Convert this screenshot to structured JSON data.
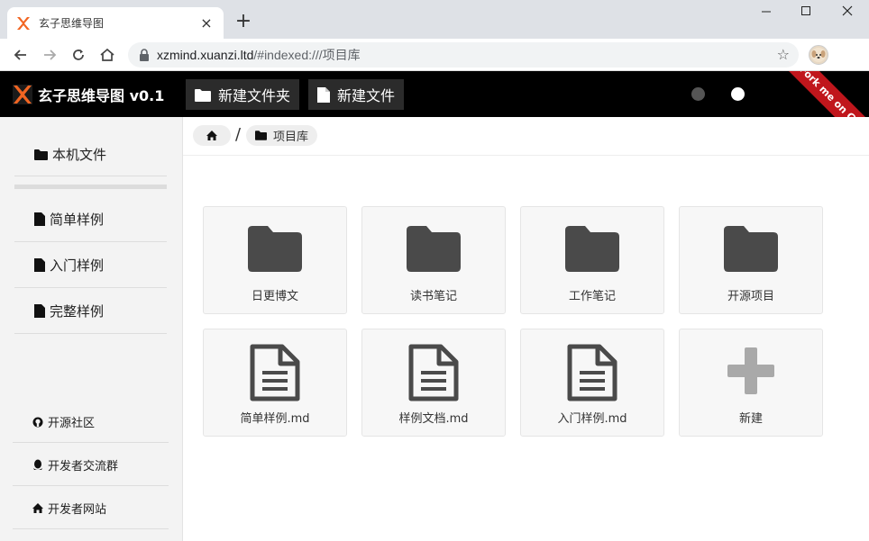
{
  "browser": {
    "tab_title": "玄子思维导图",
    "tab_close": "×",
    "new_tab": "+",
    "url_host": "xzmind.xuanzi.ltd",
    "url_rest": "/#indexed:///项目库"
  },
  "app": {
    "brand": "玄子思维导图 v0.1",
    "new_folder": "新建文件夹",
    "new_file": "新建文件",
    "ribbon": "Fork me on Gitee",
    "dark_dot_color": "#555555",
    "light_dot_color": "#ffffff",
    "accent": "#c0161c"
  },
  "sidebar": {
    "items": [
      {
        "label": "本机文件",
        "icon": "folder-icon"
      },
      {
        "label": "简单样例",
        "icon": "file-icon"
      },
      {
        "label": "入门样例",
        "icon": "file-icon"
      },
      {
        "label": "完整样例",
        "icon": "file-icon"
      }
    ],
    "links": [
      {
        "label": "开源社区",
        "icon": "github-icon"
      },
      {
        "label": "开发者交流群",
        "icon": "qq-icon"
      },
      {
        "label": "开发者网站",
        "icon": "home-icon"
      }
    ]
  },
  "breadcrumb": {
    "home_icon": "home-icon",
    "sep": "/",
    "current": "项目库"
  },
  "tiles": [
    {
      "label": "日更博文",
      "type": "folder"
    },
    {
      "label": "读书笔记",
      "type": "folder"
    },
    {
      "label": "工作笔记",
      "type": "folder"
    },
    {
      "label": "开源项目",
      "type": "folder"
    },
    {
      "label": "简单样例.md",
      "type": "file"
    },
    {
      "label": "样例文档.md",
      "type": "file"
    },
    {
      "label": "入门样例.md",
      "type": "file"
    },
    {
      "label": "新建",
      "type": "new"
    }
  ]
}
